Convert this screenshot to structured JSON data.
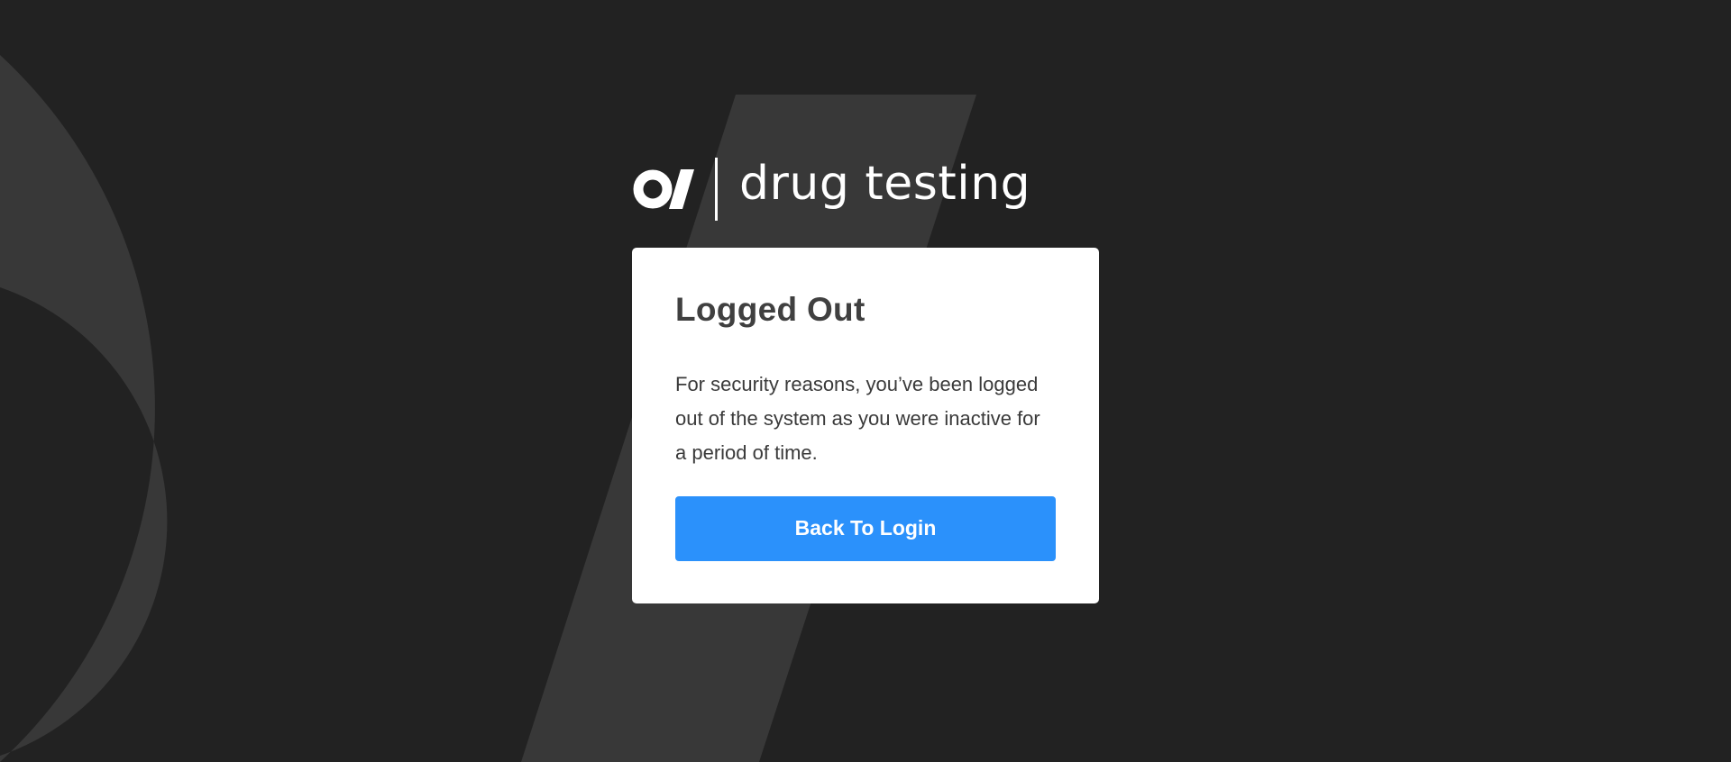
{
  "brand": {
    "product_name": "drug testing",
    "logo_icon": "o-slash-logo-icon"
  },
  "card": {
    "title": "Logged Out",
    "message": "For security reasons, you’ve been logged out of the system as you were inactive for a period of time.",
    "button_label": "Back To Login"
  },
  "colors": {
    "background": "#222222",
    "background_mark": "#383838",
    "card_background": "#ffffff",
    "title_text": "#404040",
    "body_text": "#3a3a3a",
    "button_accent": "#2b91fb",
    "button_text": "#ffffff"
  }
}
